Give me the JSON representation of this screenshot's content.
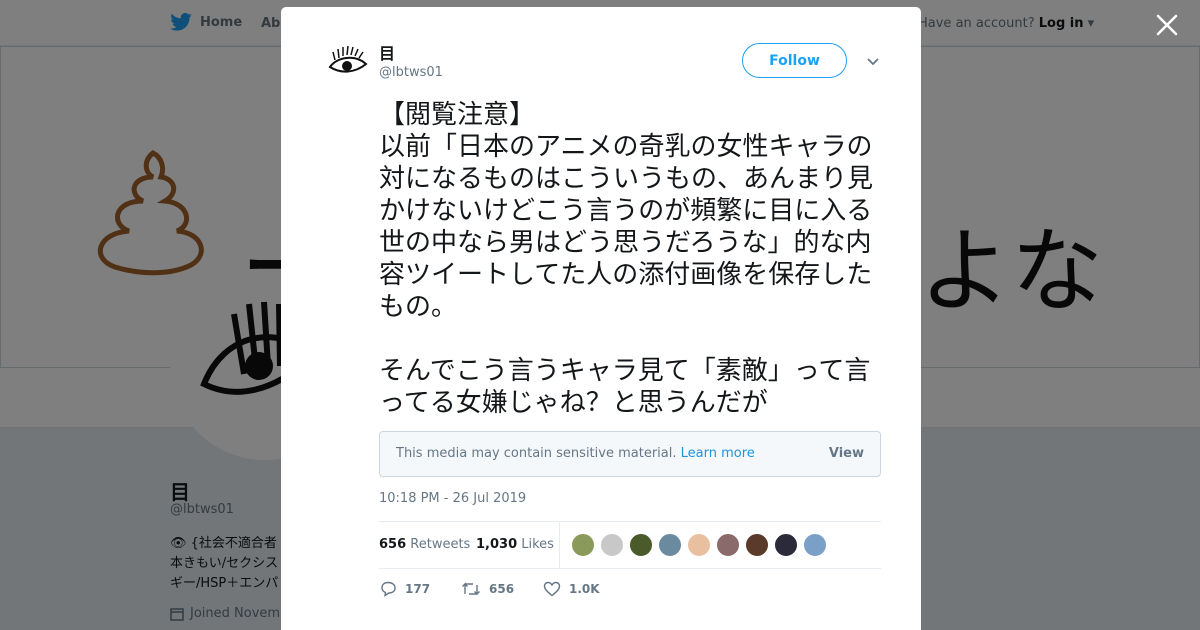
{
  "nav": {
    "home_label": "Home",
    "about_label": "About",
    "account_prompt": "Have an account?",
    "login_label": "Log in"
  },
  "banner": {
    "text_left": "コ",
    "text_right": "よな"
  },
  "profile": {
    "name": "目",
    "handle": "@lbtws01",
    "bio": "👁 {社会不適合者\n本きもい/セクシス\nギー/HSP＋エンパ",
    "joined": "Joined Novem"
  },
  "modal": {
    "author_name": "目",
    "author_handle": "@lbtws01",
    "follow_label": "Follow",
    "tweet_text": "【閲覧注意】\n以前「日本のアニメの奇乳の女性キャラの対になるものはこういうもの、あんまり見かけないけどこう言うのが頻繁に目に入る世の中なら男はどう思うだろうな」的な内容ツイートしてた人の添付画像を保存したもの。\n\nそんでこう言うキャラ見て「素敵」って言ってる女嫌じゃね？と思うんだが",
    "sensitive_message": "This media may contain sensitive material.",
    "learn_more": "Learn more",
    "view_label": "View",
    "timestamp": "10:18 PM - 26 Jul 2019",
    "retweets_count": "656",
    "retweets_label": "Retweets",
    "likes_count": "1,030",
    "likes_label": "Likes",
    "reply_count": "177",
    "retweet_action_count": "656",
    "like_action_count": "1.0K"
  },
  "colors": {
    "accent": "#1da1f2",
    "link": "#1b95e0",
    "muted": "#657786",
    "liker_avatars": [
      "#8a9a5b",
      "#c8c8c8",
      "#4a5a2a",
      "#6a8aa0",
      "#e8c0a0",
      "#8a6a6a",
      "#5a3a2a",
      "#2a2a3a",
      "#7aa0c8"
    ]
  }
}
